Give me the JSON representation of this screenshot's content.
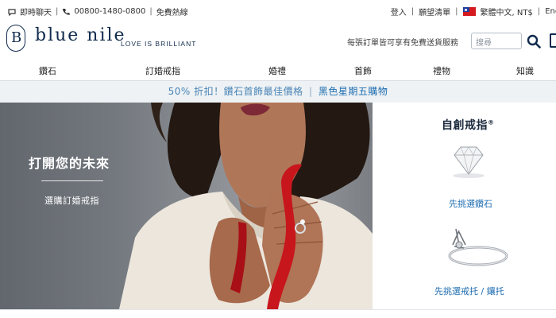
{
  "utility": {
    "chat_label": "即時聊天",
    "phone": "00800-1480-0800",
    "phone_note": "免費熱線",
    "login": "登入",
    "wishlist": "願望清單",
    "locale": "繁體中文, NT$",
    "language": "Engl"
  },
  "header": {
    "logo_monogram": "B",
    "logo_text": "blue nile",
    "tagline": "LOVE IS BRILLIANT",
    "free_shipping": "每張訂單皆可享有免費送貨服務",
    "search_placeholder": "搜尋"
  },
  "nav": {
    "items": [
      {
        "label": "鑽石"
      },
      {
        "label": "訂婚戒指"
      },
      {
        "label": "婚禮"
      },
      {
        "label": "首飾"
      },
      {
        "label": "禮物"
      },
      {
        "label": "知識"
      }
    ]
  },
  "promo": {
    "text": "50% 折扣！鑽石首飾最佳價格",
    "separator": "|",
    "link": "黑色星期五購物"
  },
  "hero": {
    "title": "打開您的未來",
    "cta": "選購訂婚戒指"
  },
  "panel": {
    "title": "自創戒指",
    "title_mark": "®",
    "link_diamond": "先挑選鑽石",
    "link_setting": "先挑選戒托 / 鑲托"
  },
  "colors": {
    "brand_navy": "#102a4c",
    "link_blue": "#1f6db1",
    "promo_bg": "#eef2f4",
    "ribbon_red": "#c8161d"
  },
  "icons": {
    "chat": "chat-bubble-icon",
    "phone": "phone-icon",
    "flag": "taiwan-flag-icon",
    "search": "search-icon",
    "bag": "shopping-bag-icon"
  }
}
